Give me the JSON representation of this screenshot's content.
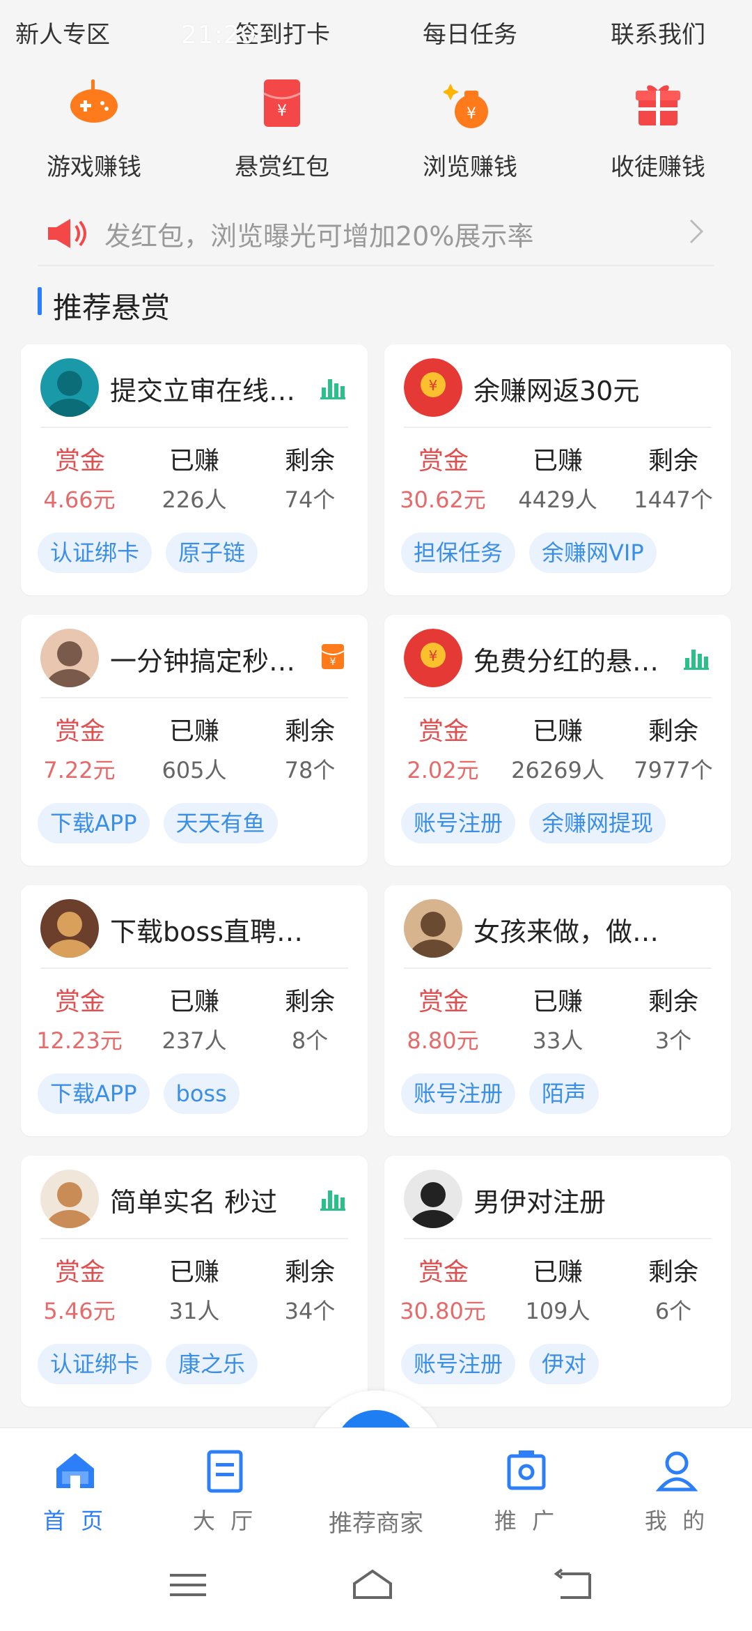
{
  "top_nav": [
    "新人专区",
    "签到打卡",
    "每日任务",
    "联系我们"
  ],
  "status_bar": {
    "time": "21:29"
  },
  "grid": [
    {
      "label": "游戏赚钱",
      "icon": "gamepad-icon"
    },
    {
      "label": "悬赏红包",
      "icon": "red-envelope-icon"
    },
    {
      "label": "浏览赚钱",
      "icon": "money-bag-icon"
    },
    {
      "label": "收徒赚钱",
      "icon": "gift-icon"
    }
  ],
  "notice": {
    "text": "发红包，浏览曝光可增加20%展示率"
  },
  "section": {
    "title": "推荐悬赏"
  },
  "column_labels": {
    "reward": "赏金",
    "earned": "已赚",
    "remaining": "剩余"
  },
  "cards": [
    {
      "title": "提交立审在线…",
      "reward": "4.66元",
      "earned": "226人",
      "remaining": "74个",
      "tags": [
        "认证绑卡",
        "原子链"
      ],
      "badge": "bar-chart-icon"
    },
    {
      "title": "余赚网返30元",
      "reward": "30.62元",
      "earned": "4429人",
      "remaining": "1447个",
      "tags": [
        "担保任务",
        "余赚网VIP"
      ],
      "badge": ""
    },
    {
      "title": "一分钟搞定秒…",
      "reward": "7.22元",
      "earned": "605人",
      "remaining": "78个",
      "tags": [
        "下载APP",
        "天天有鱼"
      ],
      "badge": "red-envelope-badge-icon"
    },
    {
      "title": "免费分红的悬…",
      "reward": "2.02元",
      "earned": "26269人",
      "remaining": "7977个",
      "tags": [
        "账号注册",
        "余赚网提现"
      ],
      "badge": "bar-chart-icon"
    },
    {
      "title": "下载boss直聘，…",
      "reward": "12.23元",
      "earned": "237人",
      "remaining": "8个",
      "tags": [
        "下载APP",
        "boss"
      ],
      "badge": ""
    },
    {
      "title": "女孩来做，做过…",
      "reward": "8.80元",
      "earned": "33人",
      "remaining": "3个",
      "tags": [
        "账号注册",
        "陌声"
      ],
      "badge": ""
    },
    {
      "title": "简单实名  秒过",
      "reward": "5.46元",
      "earned": "31人",
      "remaining": "34个",
      "tags": [
        "认证绑卡",
        "康之乐"
      ],
      "badge": "bar-chart-icon"
    },
    {
      "title": "男伊对注册",
      "reward": "30.80元",
      "earned": "109人",
      "remaining": "6个",
      "tags": [
        "账号注册",
        "伊对"
      ],
      "badge": ""
    }
  ],
  "tabbar": [
    {
      "label": "首 页",
      "icon": "home-icon",
      "active": true
    },
    {
      "label": "大 厅",
      "icon": "document-icon",
      "active": false
    },
    {
      "label": "推荐商家",
      "icon": "store-icon",
      "active": false
    },
    {
      "label": "推 广",
      "icon": "share-icon",
      "active": false
    },
    {
      "label": "我 的",
      "icon": "user-icon",
      "active": false
    }
  ],
  "colors": {
    "accent": "#2d7ff9",
    "reward_red": "#e04f4f",
    "reward_value": "#e66a6a",
    "tag_bg": "#eaf3fd",
    "tag_text": "#3a8ee6",
    "orange": "#ff7a1a"
  }
}
